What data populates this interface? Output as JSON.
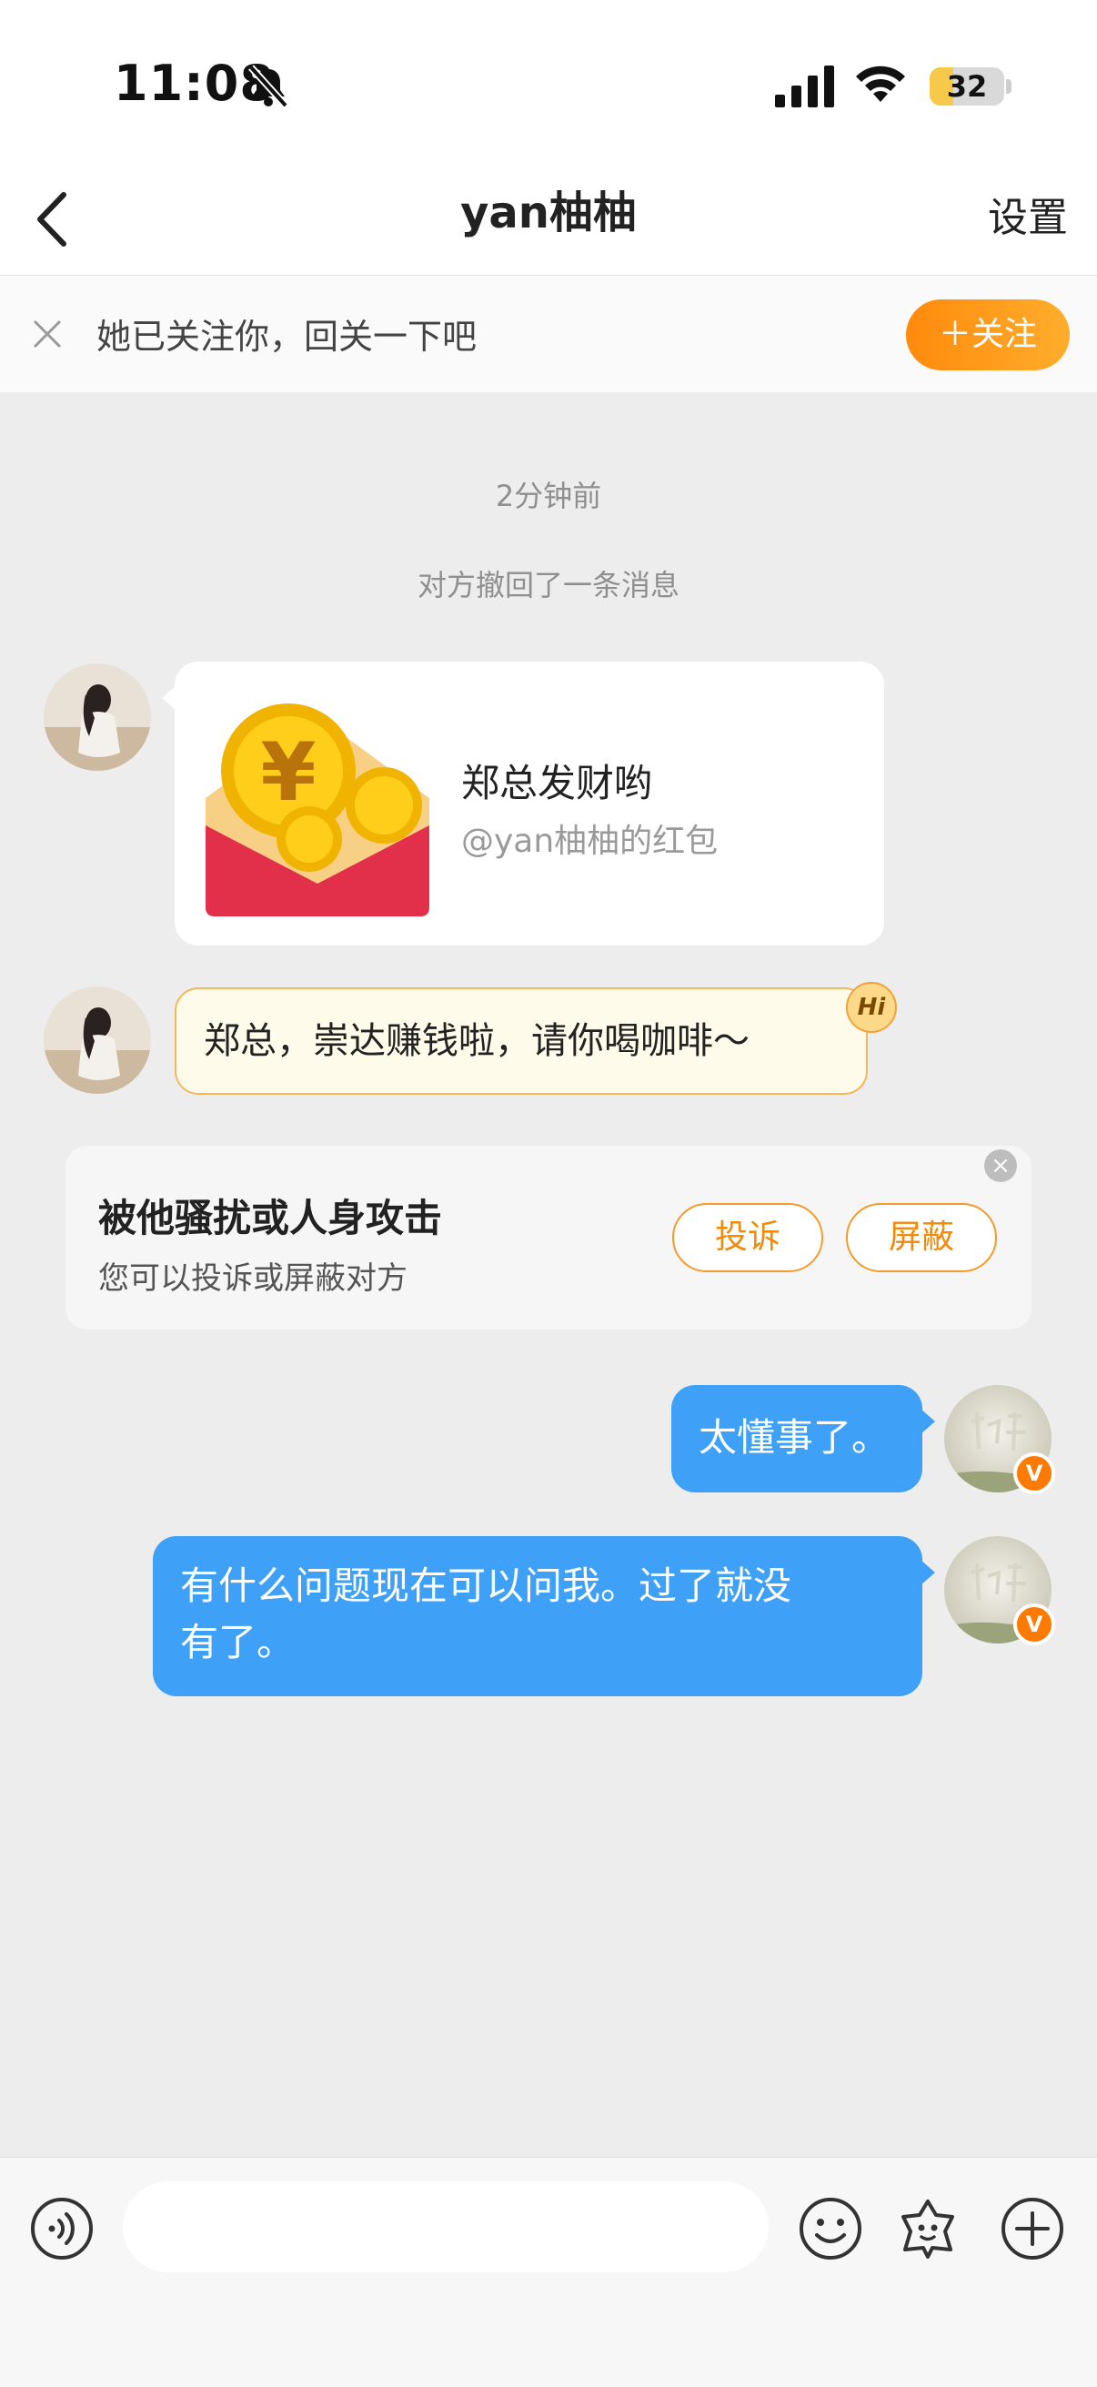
{
  "status_bar": {
    "time": "11:08",
    "battery": "32",
    "battery_level": 0.32
  },
  "header": {
    "title": "yan柚柚",
    "settings_label": "设置"
  },
  "follow_bar": {
    "text": "她已关注你，回关一下吧",
    "follow_button": "＋关注"
  },
  "chat": {
    "timestamp": "2分钟前",
    "recall_notice": "对方撤回了一条消息",
    "red_packet": {
      "title": "郑总发财哟",
      "subtitle": "@yan柚柚的红包"
    },
    "greeting_message": "郑总，崇达赚钱啦，请你喝咖啡～",
    "hi_tag": "Hi",
    "safety_card": {
      "title": "被他骚扰或人身攻击",
      "subtitle": "您可以投诉或屏蔽对方",
      "report_button": "投诉",
      "block_button": "屏蔽"
    },
    "outgoing": [
      {
        "text": "太懂事了。"
      },
      {
        "text_line1": "有什么问题现在可以问我。过了就没",
        "text_line2": "有了。"
      }
    ],
    "verified_badge": "V"
  },
  "input_bar": {
    "placeholder": ""
  },
  "colors": {
    "accent_orange": "#ff8a0c",
    "bubble_blue": "#3ea0f7",
    "bubble_yellow": "#fffbea"
  }
}
